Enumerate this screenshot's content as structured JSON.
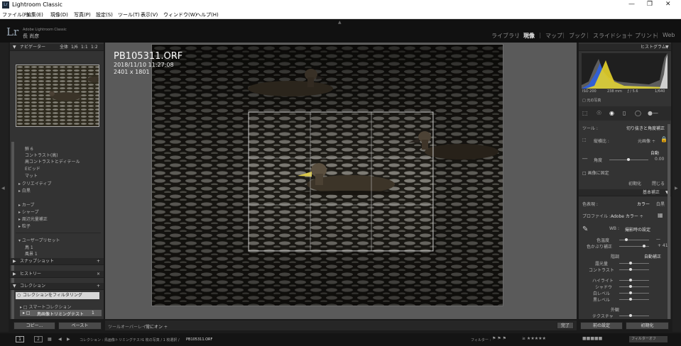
{
  "window": {
    "title": "Lightroom Classic",
    "app_icon": "Lr"
  },
  "menu": [
    "ファイル(F)",
    "編集(E)",
    "現像(D)",
    "写真(P)",
    "設定(S)",
    "ツール(T)",
    "表示(V)",
    "ウィンドウ(W)",
    "ヘルプ(H)"
  ],
  "identity": {
    "logo": "Lr",
    "line1": "Adobe Lightroom Classic",
    "line2": "長 尚彦"
  },
  "modules": [
    {
      "label": "ライブラリ",
      "active": false
    },
    {
      "label": "現像",
      "active": true
    },
    {
      "label": "マップ",
      "active": false
    },
    {
      "label": "ブック",
      "active": false
    },
    {
      "label": "スライドショー",
      "active": false
    },
    {
      "label": "プリント",
      "active": false
    },
    {
      "label": "Web",
      "active": false
    }
  ],
  "navigator": {
    "title": "ナビゲーター",
    "zoom": [
      "全体",
      "1/6",
      "1:1",
      "1:2"
    ]
  },
  "presets": {
    "items": [
      "鮮 6",
      "コントラスト(高)",
      "高コントラストとディテール",
      "Eビッド",
      "マット"
    ],
    "groups": [
      "クリエイティブ",
      "白黒",
      "カーブ",
      "シャープ",
      "周辺光量補正",
      "粒子"
    ],
    "user_presets": {
      "label": "ユーザープリセット",
      "items": [
        "鳥 1",
        "風景 1"
      ]
    }
  },
  "left_panels": {
    "snapshot": "スナップショット",
    "history": "ヒストリー",
    "collections": "コレクション"
  },
  "collections": {
    "filter": "コレクションをフィルタリング",
    "smart": "スマートコレクション",
    "item": "鳥画像トリミングテスト",
    "count": "1"
  },
  "left_buttons": {
    "copy": "コピー...",
    "paste": "ペースト"
  },
  "photo_info": {
    "filename": "PB105311.ORF",
    "datetime": "2018/11/10 11:27:08",
    "dimensions": "2401 x 1801"
  },
  "histogram": {
    "title": "ヒストグラム",
    "iso": "ISO 200",
    "focal": "238 mm",
    "aperture": "ƒ / 5.6",
    "shutter": "1/640",
    "original": "元の写真"
  },
  "crop": {
    "tool_label": "ツール :",
    "tool_name": "切り抜きと角度補正",
    "aspect_label": "縦横比 :",
    "aspect_value": "元画像",
    "angle_label": "角度",
    "angle_value": "0.00",
    "auto": "自動",
    "constrain": "画像に固定",
    "reset": "初期化",
    "close": "閉じる"
  },
  "basic": {
    "title": "基本補正",
    "treatment_label": "色表現 :",
    "color": "カラー",
    "bw": "白黒",
    "profile_label": "プロファイル :",
    "profile_value": "Adobe カラー",
    "wb_label": "WB :",
    "wb_value": "撮影時の設定",
    "temp_label": "色温度",
    "tint_label": "色かぶり補正",
    "tint_value": "+ 41",
    "tone_label": "階調",
    "tone_auto": "自動補正",
    "exposure": "露光量",
    "contrast": "コントラスト",
    "highlights": "ハイライト",
    "shadows": "シャドウ",
    "whites": "白レベル",
    "blacks": "黒レベル",
    "presence": "外観",
    "texture": "テクスチャ"
  },
  "right_buttons": {
    "previous": "前の設定",
    "reset": "初期化"
  },
  "toolbar": {
    "overlay_label": "ツールオーバーレイ :",
    "overlay_value": "常にオン ÷",
    "done": "完了"
  },
  "filmstrip": {
    "pages": [
      "1",
      "2"
    ],
    "path": "コレクション : 鳥画像トリミングテスト",
    "count": "1 枚の写真 / 1 枚選択 /",
    "file": "PB105311.ORF",
    "filter_label": "フィルター :",
    "filter_value": "フィルターオフ"
  },
  "colors": {
    "accent": "#ffffff",
    "panel": "#333333",
    "background": "#1b1b1b"
  }
}
